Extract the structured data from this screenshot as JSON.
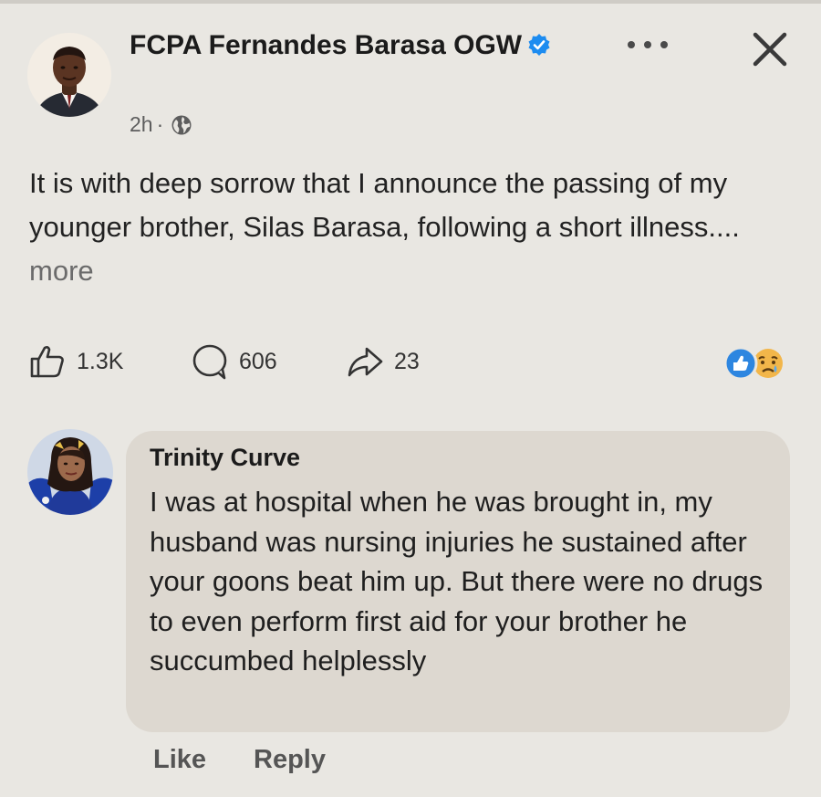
{
  "post": {
    "author_name": "FCPA Fernandes Barasa OGW",
    "time": "2h",
    "separator": "·",
    "text": "It is with deep sorrow that I announce the passing of my younger brother, Silas Barasa, following a short illness....",
    "more_label": "more"
  },
  "stats": {
    "likes": "1.3K",
    "comments": "606",
    "shares": "23"
  },
  "comment": {
    "author_name": "Trinity Curve",
    "text": "I was at hospital when he was brought in, my husband was nursing injuries he sustained after your goons beat him up. But there were no drugs to even perform first aid for your brother he succumbed helplessly",
    "like_label": "Like",
    "reply_label": "Reply"
  },
  "icons": {
    "verified": "verified-badge-icon",
    "audience": "globe-icon",
    "menu": "more-horizontal-icon",
    "close": "close-icon",
    "like": "thumbs-up-icon",
    "comment": "comment-bubble-icon",
    "share": "share-arrow-icon",
    "reactions": [
      "like-reaction-icon",
      "sad-reaction-icon"
    ]
  },
  "colors": {
    "background": "#e9e7e2",
    "bubble": "#ddd8d0",
    "verified_blue": "#1d8cf0",
    "reaction_like": "#2d86e0",
    "reaction_sad": "#f2b64a"
  }
}
